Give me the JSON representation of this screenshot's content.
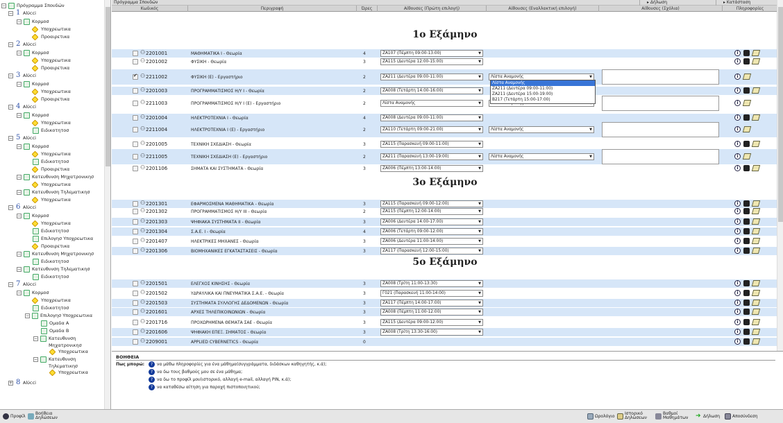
{
  "tree": {
    "root": "Πρόγραμμα Σπουδών",
    "semester_word": "Αlύcci"
  },
  "titlebar": {
    "title": "Πρόγραμμα Σπουδών",
    "dilosi": "Δήλωση",
    "katastasi": "Κατάσταση"
  },
  "header": {
    "code": "Κωδικός",
    "desc": "Περιγραφή",
    "hours": "Ώρες",
    "primary": "Αίθουσες (Πρώτη επιλογή)",
    "alt": "Αίθουσες (Εναλλακτική επιλογή)",
    "comments": "Αίθουσες (Σχόλια)",
    "info": "Πληροφορίες"
  },
  "semesters": [
    "1ο Εξάμηνο",
    "3ο Εξάμηνο",
    "5ο Εξάμηνο"
  ],
  "rows": [
    {
      "code": "2201001",
      "desc": "ΜΑΘΗΜΑΤΙΚΑ Ι - Θεωρία",
      "hours": "4",
      "room": "ΖΑ107 (Πέμπτη 09:00-13:00)"
    },
    {
      "code": "2201002",
      "desc": "ΦΥΣΙΚΗ - Θεωρία",
      "hours": "3",
      "room": "ΖΑ115 (Δευτέρα 12:00-15:00)"
    },
    {
      "code": "2211002",
      "desc": "ΦΥΣΙΚΗ (Ε) - Εργαστήριο",
      "hours": "2",
      "room": "ΖΑ211 (Δευτέρα 09:00-11:00)",
      "alt": "Λίστα Αναμονής"
    },
    {
      "code": "2201003",
      "desc": "ΠΡΟΓΡΑΜΜΑΤΙΣΜΟΣ Η/Υ Ι - Θεωρία",
      "hours": "2",
      "room": "ΖΑ008 (Τετάρτη 14:00-16:00)"
    },
    {
      "code": "2211003",
      "desc": "ΠΡΟΓΡΑΜΜΑΤΙΣΜΟΣ Η/Υ Ι (Ε) - Εργαστήριο",
      "hours": "2",
      "room": "Λίστα Αναμονής",
      "alt": "Λίστα Αναμονής"
    },
    {
      "code": "2201004",
      "desc": "ΗΛΕΚΤΡΟΤΕΧΝΙΑ Ι - Θεωρία",
      "hours": "4",
      "room": "ΖΑ008 (Δευτέρα 09:00-11:00)"
    },
    {
      "code": "2211004",
      "desc": "ΗΛΕΚΤΡΟΤΕΧΝΙΑ Ι (Ε) - Εργαστήριο",
      "hours": "2",
      "room": "ΖΑ110 (Τετάρτη 09:00-21:00)",
      "alt": "Λίστα Αναμονής"
    },
    {
      "code": "2201005",
      "desc": "ΤΕΧΝΙΚΗ ΣΧΕΔΙΑΣΗ - Θεωρία",
      "hours": "3",
      "room": "ΖΑ115 (Παρασκευή 09:00-11:00)"
    },
    {
      "code": "2211005",
      "desc": "ΤΕΧΝΙΚΗ ΣΧΕΔΙΑΣΗ (Ε) - Εργαστήριο",
      "hours": "2",
      "room": "ΖΑ211 (Παρασκευή 13:00-19:00)",
      "alt": "Λίστα Αναμονής"
    },
    {
      "code": "2201106",
      "desc": "ΣΗΜΑΤΑ ΚΑΙ ΣΥΣΤΗΜΑΤΑ - Θεωρία",
      "hours": "3",
      "room": "ΖΑ006 (Πέμπτη 13:00-14:00)"
    },
    {
      "code": "2201301",
      "desc": "ΕΦΑΡΜΟΣΜΕΝΑ ΜΑΘΗΜΑΤΙΚΑ - Θεωρία",
      "hours": "3",
      "room": "ΖΑ115 (Παρασκευή 09:00-12:00)"
    },
    {
      "code": "2201302",
      "desc": "ΠΡΟΓΡΑΜΜΑΤΙΣΜΟΣ Η/Υ ΙΙΙ - Θεωρία",
      "hours": "2",
      "room": "ΖΑ115 (Πέμπτη 12:00-14:00)"
    },
    {
      "code": "2201303",
      "desc": "ΨΗΦΙΑΚΑ ΣΥΣΤΗΜΑΤΑ ΙΙ - Θεωρία",
      "hours": "3",
      "room": "ΖΑ006 (Δευτέρα 14:00-17:00)"
    },
    {
      "code": "2201304",
      "desc": "Σ.Α.Ε. Ι - Θεωρία",
      "hours": "4",
      "room": "ΖΑ006 (Τετάρτη 09:00-12:00)"
    },
    {
      "code": "2201407",
      "desc": "ΗΛΕΚΤΡΙΚΕΣ ΜΗΧΑΝΕΣ - Θεωρία",
      "hours": "3",
      "room": "ΖΑ006 (Δευτέρα 11:00-14:00)"
    },
    {
      "code": "2201306",
      "desc": "ΒΙΟΜΗΧΑΝΙΚΕΣ ΕΓΚΑΤΑΣΤΑΣΕΙΣ - Θεωρία",
      "hours": "3",
      "room": "ΖΑ117 (Παρασκευή 12:00-15:00)"
    },
    {
      "code": "2201501",
      "desc": "ΕΛΕΓΧΟΣ ΚΙΝΗΣΗΣ - Θεωρία",
      "hours": "3",
      "room": "ΖΑ008 (Τρίτη 11:00-13:30)"
    },
    {
      "code": "2201502",
      "desc": "ΥΔΡΑΥΛΙΚΑ ΚΑΙ ΠΝΕΥΜΑΤΙΚΑ Σ.Α.Ε. - Θεωρία",
      "hours": "3",
      "room": "Γ021 (Παρασκευή 11:00-14:00)"
    },
    {
      "code": "2201503",
      "desc": "ΣΥΣΤΗΜΑΤΑ ΣΥΛΛΟΓΗΣ ΔΕΔΟΜΕΝΩΝ - Θεωρία",
      "hours": "3",
      "room": "ΖΑ117 (Πέμπτη 14:00-17:00)"
    },
    {
      "code": "2201601",
      "desc": "ΑΡΧΕΣ ΤΗΛΕΠΙΚΟΙΝΩΝΙΩΝ - Θεωρία",
      "hours": "3",
      "room": "ΖΑ008 (Πέμπτη 11:00-12:00)"
    },
    {
      "code": "2201716",
      "desc": "ΠΡΟΧΩΡΗΜΕΝΑ ΘΕΜΑΤΑ ΣΑΕ - Θεωρία",
      "hours": "3",
      "room": "ΖΑ115 (Δευτέρα 09:00-12:00)"
    },
    {
      "code": "2201606",
      "desc": "ΨΗΦΙΑΚΗ ΕΠΕΞ. ΣΗΜΑΤΟΣ - Θεωρία",
      "hours": "3",
      "room": "ΖΑ008 (Τρίτη 13:30-16:00)"
    },
    {
      "code": "2209001",
      "desc": "APPLIED CYBERNETICS - Θεωρία",
      "hours": "0",
      "room": ""
    }
  ],
  "dropdown": [
    "Λίστα Αναμονής",
    "ΖΑ211 (Δευτέρα 09:00-11:00)",
    "ΖΑ211 (Δευτέρα 15:00-19:00)",
    "Β217 (Τετάρτη 15:00-17:00)"
  ],
  "help": {
    "title": "ΒΟΗΘΕΙΑ",
    "how": "Πως μπορώ:",
    "items": [
      "να μάθω πληροφορίες για ένα μάθημα(συγγράμματα, διδάσκων καθηγητής, κ.ά);",
      "να δω τους βαθμούς μου σε ένα μάθημα;",
      "να δω το προφίλ μου(ιστορικό, αλλαγή e-mail, αλλαγή PIN, κ.ά);",
      "να καταθέσω αίτηση για παροχή πιστοποιητικού;"
    ]
  },
  "footer": {
    "profile": "Προφίλ",
    "help1": "Βοήθεια",
    "help2": "Δηλώσεων",
    "schedule": "Ωρολόγιο",
    "history1": "Ιστορικό",
    "history2": "Δηλώσεων",
    "grades1": "Βαθμοί",
    "grades2": "Μαθημάτων",
    "submit": "Δήλωση",
    "logout": "Αποσύνδεση"
  },
  "tree_labels": {
    "kormos": "Κορμοσ",
    "ypo": "Υποχρεωτικα",
    "proair": "Προαιρετικα",
    "eidik": "Ειδικοτητοσ",
    "mix": "Κατευθυνση Μηχατρονικησ",
    "til": "Κατευθυνση Τηλεματικησ",
    "epil": "Επιλογησ Υποχρεωτικα",
    "oma": "Ομαδα Α",
    "omb": "Ομαδα Β",
    "mix2a": "Κατευθυνση",
    "mix2b": "Μηχατρονικησ",
    "til2b": "Τηλεματικησ"
  },
  "colors": {
    "accent": "#3355aa",
    "row_alt": "#d6e6f8"
  }
}
